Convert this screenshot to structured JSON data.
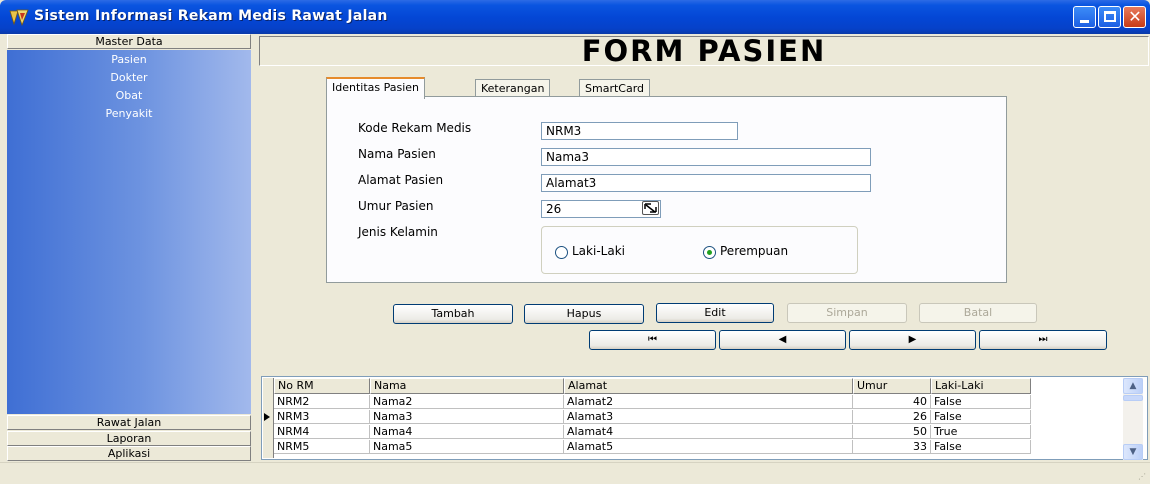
{
  "window": {
    "title": "Sistem Informasi Rekam Medis Rawat Jalan",
    "icon": "delphi-app-icon",
    "controls": {
      "minimize": "minimize-icon",
      "maximize": "maximize-icon",
      "close": "close-icon"
    }
  },
  "sidebar": {
    "top_header": "Master Data",
    "items": [
      "Pasien",
      "Dokter",
      "Obat",
      "Penyakit"
    ],
    "bottom_headers": [
      "Rawat Jalan",
      "Laporan",
      "Aplikasi"
    ]
  },
  "form": {
    "title": "FORM PASIEN",
    "tabs": [
      "Identitas Pasien",
      "Keterangan",
      "SmartCard"
    ],
    "fields": {
      "kode_label": "Kode Rekam Medis",
      "kode_value": "NRM3",
      "nama_label": "Nama Pasien",
      "nama_value": "Nama3",
      "alamat_label": "Alamat Pasien",
      "alamat_value": "Alamat3",
      "umur_label": "Umur Pasien",
      "umur_value": "26",
      "jenis_label": "Jenis Kelamin"
    },
    "gender_options": {
      "male": "Laki-Laki",
      "female": "Perempuan",
      "selected": "Perempuan"
    },
    "buttons": {
      "tambah": "Tambah",
      "hapus": "Hapus",
      "edit": "Edit",
      "simpan": "Simpan",
      "batal": "Batal"
    },
    "navigator": {
      "first": "first-record-icon",
      "prior": "prior-record-icon",
      "next": "next-record-icon",
      "last": "last-record-icon"
    }
  },
  "grid": {
    "columns": [
      "No RM",
      "Nama",
      "Alamat",
      "Umur",
      "Laki-Laki"
    ],
    "rows": [
      [
        "NRM2",
        "Nama2",
        "Alamat2",
        "40",
        "False"
      ],
      [
        "NRM3",
        "Nama3",
        "Alamat3",
        "26",
        "False"
      ],
      [
        "NRM4",
        "Nama4",
        "Alamat4",
        "50",
        "True"
      ],
      [
        "NRM5",
        "Nama5",
        "Alamat5",
        "33",
        "False"
      ]
    ],
    "current_row": 1
  },
  "colors": {
    "titlebar": "#0447d6",
    "sidebar": "#6d93e0",
    "tab_accent": "#e68b2c",
    "radio_selected": "#21a121"
  }
}
